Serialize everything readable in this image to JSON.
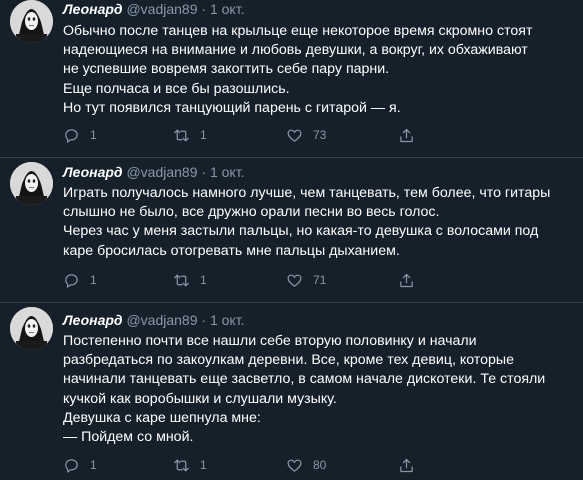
{
  "tweets": [
    {
      "author": "Леонард",
      "handle": "@vadjan89",
      "separator": "·",
      "date": "1 окт.",
      "lines": [
        "Обычно после танцев на крыльце  еще некоторое время скромно стоят",
        "надеющиеся на внимание и любовь девушки, а вокруг, их обхаживают",
        "не успевшие вовремя закогтить себе пару парни.",
        "Еще полчаса и все бы разошлись.",
        "Но тут появился танцующий парень с гитарой — я."
      ],
      "reply_count": "1",
      "retweet_count": "1",
      "like_count": "73"
    },
    {
      "author": "Леонард",
      "handle": "@vadjan89",
      "separator": "·",
      "date": "1 окт.",
      "lines": [
        "Играть получалось намного лучше, чем танцевать, тем более, что гитары",
        "слышно не было, все дружно орали песни во весь голос.",
        "Через час у меня застыли пальцы, но какая-то девушка с волосами под",
        "каре бросилась отогревать мне пальцы дыханием."
      ],
      "reply_count": "1",
      "retweet_count": "1",
      "like_count": "71"
    },
    {
      "author": "Леонард",
      "handle": "@vadjan89",
      "separator": "·",
      "date": "1 окт.",
      "lines": [
        "Постепенно почти все нашли себе вторую половинку и начали",
        "разбредаться по закоулкам деревни. Все, кроме тех девиц, которые",
        "начинали танцевать еще засветло, в самом начале дискотеки. Те стояли",
        "кучкой как воробышки и слушали музыку.",
        "Девушка с каре шепнула мне:",
        "— Пойдем со мной."
      ],
      "reply_count": "1",
      "retweet_count": "1",
      "like_count": "80"
    }
  ],
  "icons": {
    "avatar": "masked-face-avatar",
    "reply": "reply-icon",
    "retweet": "retweet-icon",
    "like": "heart-icon",
    "share": "share-icon"
  },
  "colors": {
    "background": "#15202b",
    "text": "#ffffff",
    "secondary": "#8899a6",
    "divider": "#38444d"
  }
}
